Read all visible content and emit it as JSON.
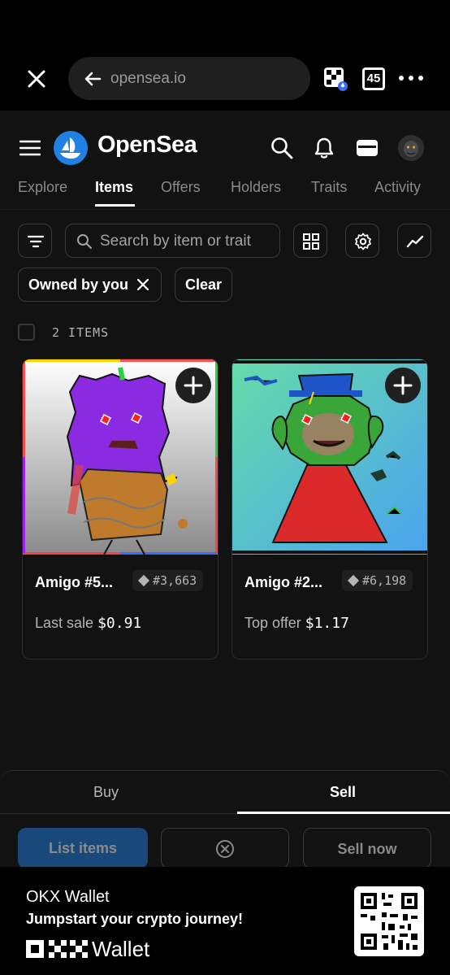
{
  "browser": {
    "url": "opensea.io",
    "tab_count": "45"
  },
  "header": {
    "brand": "OpenSea"
  },
  "tabs": [
    {
      "label": "Explore"
    },
    {
      "label": "Items"
    },
    {
      "label": "Offers"
    },
    {
      "label": "Holders"
    },
    {
      "label": "Traits"
    },
    {
      "label": "Activity"
    }
  ],
  "filters": {
    "search_placeholder": "Search by item or trait",
    "chip_owned": "Owned by you",
    "chip_clear": "Clear"
  },
  "items_count": "2 ITEMS",
  "cards": [
    {
      "name": "Amigo #5...",
      "rank": "#3,663",
      "price_label": "Last sale",
      "price": "$0.91"
    },
    {
      "name": "Amigo #2...",
      "rank": "#6,198",
      "price_label": "Top offer",
      "price": "$1.17"
    }
  ],
  "sheet": {
    "buy_tab": "Buy",
    "sell_tab": "Sell",
    "list_items": "List items",
    "sell_now": "Sell now"
  },
  "banner": {
    "title": "OKX Wallet",
    "tagline": "Jumpstart your crypto journey!",
    "wallet_word": "Wallet"
  },
  "colors": {
    "accent": "#2081e2",
    "background": "#121212"
  }
}
